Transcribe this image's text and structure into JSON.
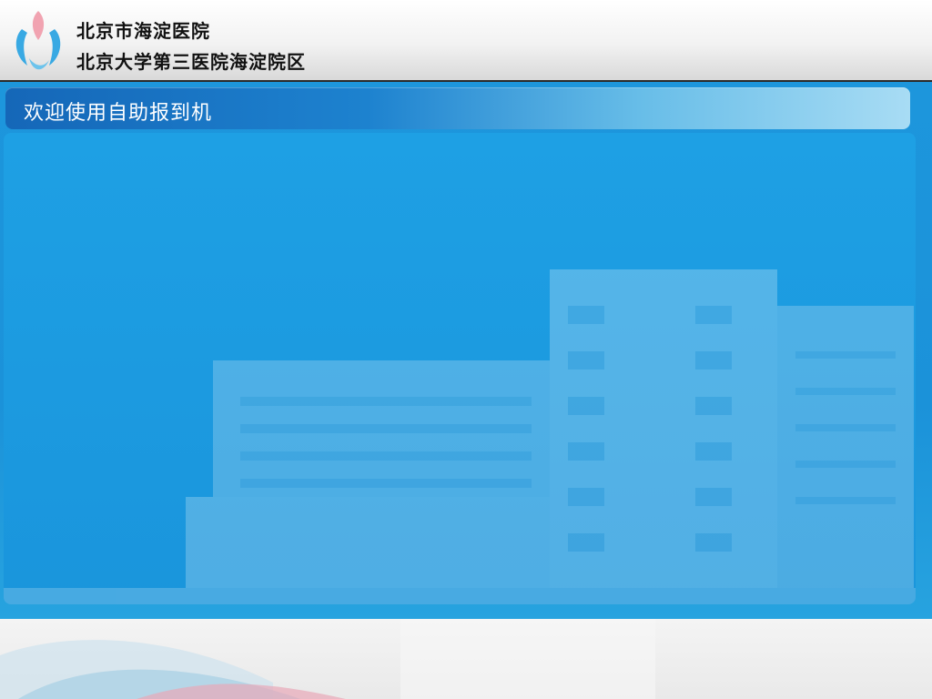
{
  "header": {
    "hospital_name": "北京市海淀医院",
    "hospital_subname": "北京大学第三医院海淀院区",
    "logo_icon": "hospital-logo-icon"
  },
  "main": {
    "title": "欢迎使用自助报到机"
  },
  "colors": {
    "accent_blue": "#1d96dc",
    "title_bar_dark": "#1567b8",
    "logo_pink": "#f1a3b1",
    "logo_blue": "#39a9e3"
  }
}
